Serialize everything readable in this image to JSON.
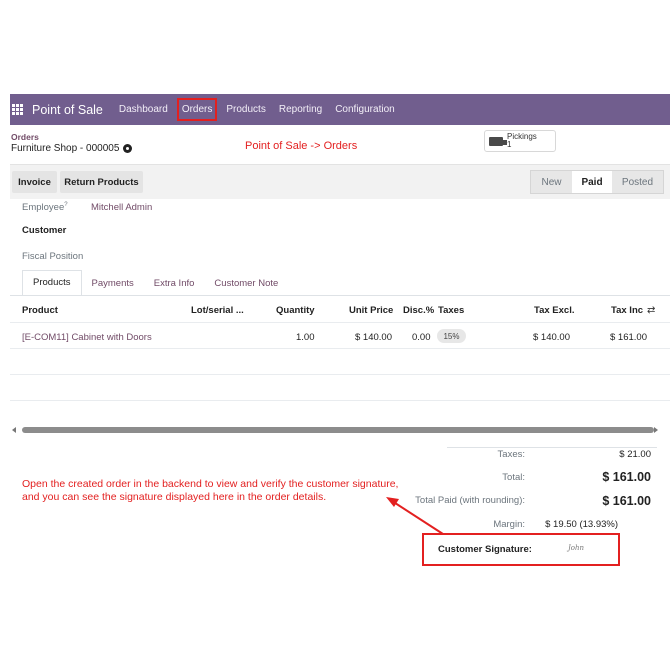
{
  "nav": {
    "brand": "Point of Sale",
    "items": [
      "Dashboard",
      "Orders",
      "Products",
      "Reporting",
      "Configuration"
    ],
    "active": "Orders"
  },
  "breadcrumb": {
    "parent": "Orders",
    "current": "Furniture Shop - 000005"
  },
  "annotation_title": "Point of Sale -> Orders",
  "pickings": {
    "label": "Pickings",
    "count": "1"
  },
  "actions": {
    "invoice": "Invoice",
    "return_products": "Return Products"
  },
  "status": {
    "steps": [
      "New",
      "Paid",
      "Posted"
    ],
    "current": "Paid"
  },
  "form": {
    "employee_label": "Employee",
    "employee_help": "?",
    "employee_value": "Mitchell Admin",
    "customer_label": "Customer",
    "fiscal_label": "Fiscal Position"
  },
  "tabs": [
    "Products",
    "Payments",
    "Extra Info",
    "Customer Note"
  ],
  "table": {
    "headers": [
      "Product",
      "Lot/serial ...",
      "Quantity",
      "Unit Price",
      "Disc.%",
      "Taxes",
      "Tax Excl.",
      "Tax Inc"
    ],
    "rows": [
      {
        "product": "[E-COM11] Cabinet with Doors",
        "quantity": "1.00",
        "unit_price": "$ 140.00",
        "discount": "0.00",
        "taxes": "15%",
        "tax_excl": "$ 140.00",
        "tax_incl": "$ 161.00"
      }
    ]
  },
  "totals": {
    "taxes_label": "Taxes:",
    "taxes_value": "$ 21.00",
    "total_label": "Total:",
    "total_value": "$ 161.00",
    "paid_label": "Total Paid (with rounding):",
    "paid_value": "$ 161.00",
    "margin_label": "Margin:",
    "margin_value": "$ 19.50 (13.93%)",
    "signature_label": "Customer Signature:",
    "signature_value": "John"
  },
  "annotation_note": [
    "Open the created order in the backend to view and verify the customer signature,",
    "and you can see the signature displayed here in the order details."
  ],
  "colors": {
    "navbar": "#715e8e",
    "link": "#714b67",
    "annotation": "#e32020"
  }
}
